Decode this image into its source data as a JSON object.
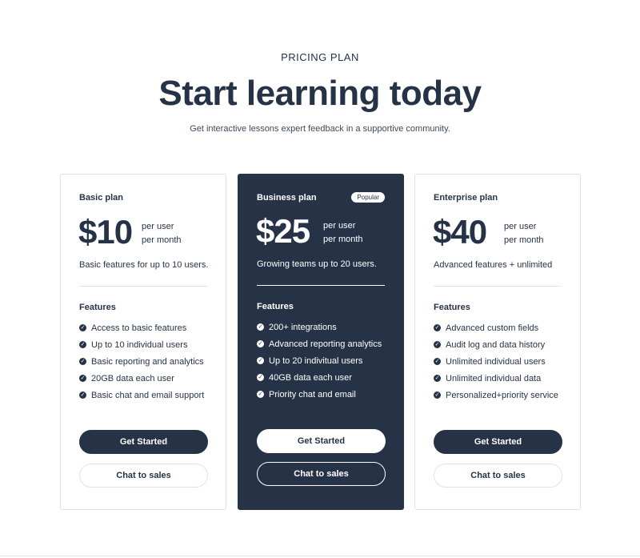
{
  "header": {
    "eyebrow": "PRICING PLAN",
    "title": "Start learning today",
    "subtitle": "Get interactive lessons expert feedback in a supportive community."
  },
  "plans": [
    {
      "name": "Basic plan",
      "price": "$10",
      "per_line1": "per user",
      "per_line2": "per month",
      "description": "Basic features for up to 10 users.",
      "features_title": "Features",
      "features": [
        "Access to basic features",
        "Up to 10 individual users",
        "Basic reporting and analytics",
        "20GB data each user",
        "Basic chat and email support"
      ],
      "primary_button": "Get Started",
      "secondary_button": "Chat to sales"
    },
    {
      "name": "Business plan",
      "badge": "Popular",
      "price": "$25",
      "per_line1": "per user",
      "per_line2": "per month",
      "description": "Growing teams up to 20 users.",
      "features_title": "Features",
      "features": [
        "200+ integrations",
        "Advanced reporting analytics",
        "Up to 20 indivitual users",
        "40GB data each user",
        "Priority chat and email"
      ],
      "primary_button": "Get Started",
      "secondary_button": "Chat to sales"
    },
    {
      "name": "Enterprise plan",
      "price": "$40",
      "per_line1": "per user",
      "per_line2": "per month",
      "description": "Advanced features + unlimited",
      "features_title": "Features",
      "features": [
        "Advanced custom fields",
        "Audit log and data history",
        "Unlimited individual users",
        "Unlimited individual data",
        "Personalized+priority service"
      ],
      "primary_button": "Get Started",
      "secondary_button": "Chat to sales"
    }
  ],
  "colors": {
    "primary": "#263347",
    "background": "#ffffff",
    "border": "#dfe2e7"
  },
  "icons": {
    "feature_check": "check-circle-icon"
  }
}
